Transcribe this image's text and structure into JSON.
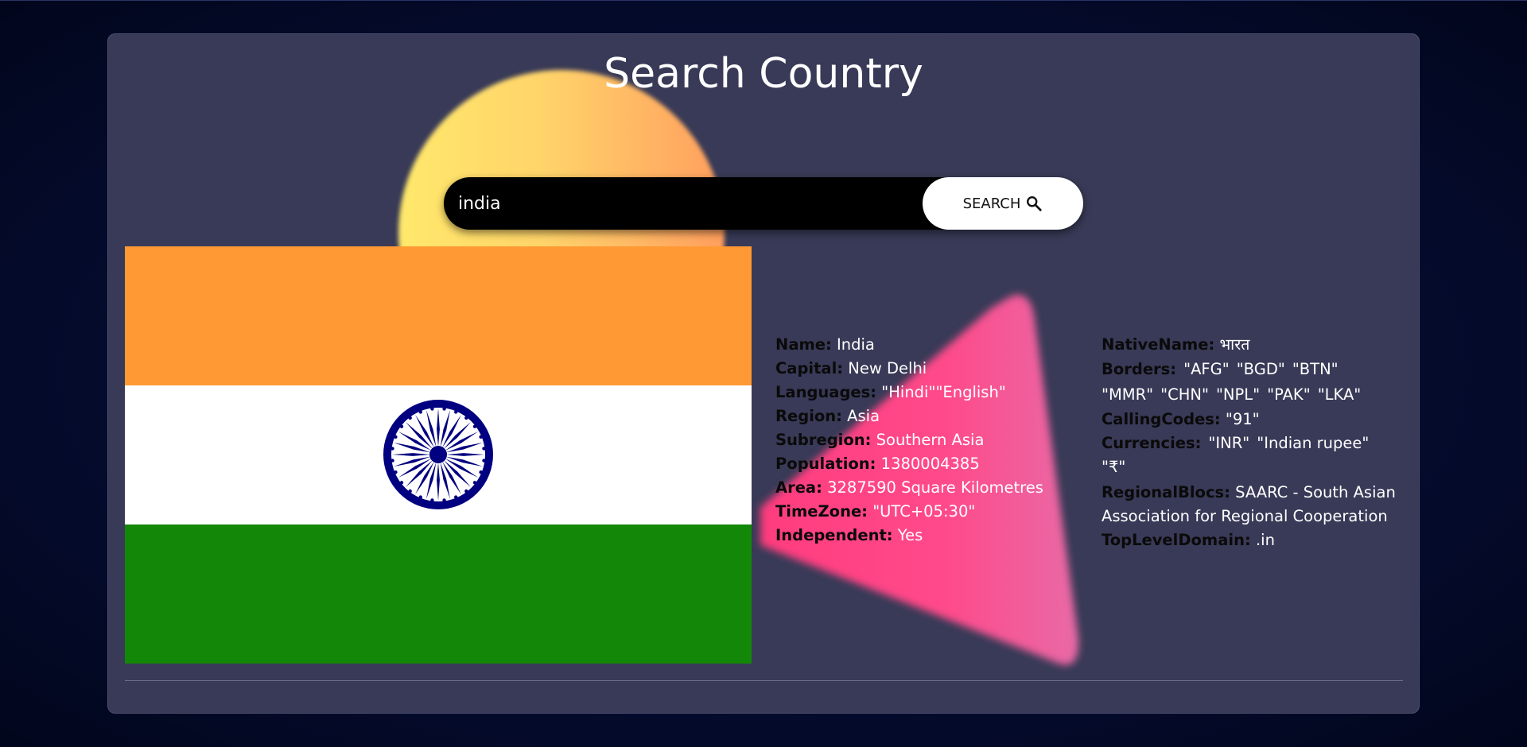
{
  "title": "Search Country",
  "search": {
    "value": "india",
    "placeholder": "",
    "button_label": "SEARCH"
  },
  "flag": {
    "country": "India",
    "colors": {
      "saffron": "#ff9933",
      "white": "#ffffff",
      "green": "#138808",
      "chakra": "#000080"
    }
  },
  "details": {
    "left": [
      {
        "label": "Name:",
        "value": "India"
      },
      {
        "label": "Capital:",
        "value": "New Delhi"
      },
      {
        "label": "Languages:",
        "value": "\"Hindi\"\"English\""
      },
      {
        "label": "Region:",
        "value": "Asia"
      },
      {
        "label": "Subregion:",
        "value": "Southern Asia"
      },
      {
        "label": "Population:",
        "value": "1380004385"
      },
      {
        "label": "Area:",
        "value": "3287590 Square Kilometres"
      },
      {
        "label": "TimeZone:",
        "value": "\"UTC+05:30\""
      },
      {
        "label": "Independent:",
        "value": "Yes"
      }
    ],
    "native_name": {
      "label": "NativeName:",
      "value": "भारत"
    },
    "borders": {
      "label": "Borders:",
      "values": [
        "\"AFG\"",
        "\"BGD\"",
        "\"BTN\"",
        "\"MMR\"",
        "\"CHN\"",
        "\"NPL\"",
        "\"PAK\"",
        "\"LKA\""
      ]
    },
    "calling_codes": {
      "label": "CallingCodes:",
      "value": "\"91\""
    },
    "currencies": {
      "label": "Currencies:",
      "values": [
        "\"INR\"",
        "\"Indian rupee\"",
        "\"₹\""
      ]
    },
    "regional_blocs": {
      "label": "RegionalBlocs:",
      "value": "SAARC - South Asian Association for Regional Cooperation"
    },
    "top_level_domain": {
      "label": "TopLevelDomain:",
      "value": ".in"
    }
  },
  "icons": {
    "search": "search-icon",
    "chakra": "ashoka-chakra-icon"
  },
  "colors": {
    "background": "#040a2a",
    "card": "#383a57",
    "label_text": "#0a0a0a",
    "value_text": "#ffffff",
    "circle_blob": "#ffd36a",
    "triangle_blob": "#ff4a8a"
  }
}
